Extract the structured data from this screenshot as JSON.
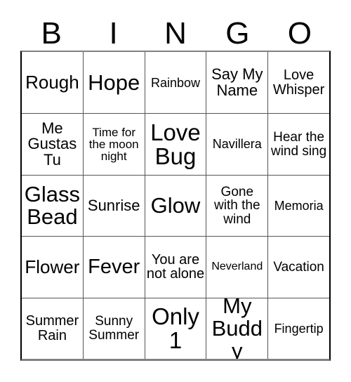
{
  "card": {
    "title_letters": [
      "B",
      "I",
      "N",
      "G",
      "O"
    ],
    "columns": 5,
    "rows": 5,
    "border_color": "#000000",
    "grid_line_color": "#555555",
    "background_color": "#ffffff",
    "text_color": "#000000",
    "rows_data": [
      [
        {
          "text": "Rough",
          "size": "fs-xl"
        },
        {
          "text": "Hope",
          "size": "fs-xxxl"
        },
        {
          "text": "Rainbow",
          "size": "fs-sm"
        },
        {
          "text": "Say My Name",
          "size": "fs-l"
        },
        {
          "text": "Love Whisper",
          "size": "fs-ml"
        }
      ],
      [
        {
          "text": "Me Gustas Tu",
          "size": "fs-l"
        },
        {
          "text": "Time for the moon night",
          "size": "fs-s"
        },
        {
          "text": "Love Bug",
          "size": "fs-huge"
        },
        {
          "text": "Navillera",
          "size": "fs-sm"
        },
        {
          "text": "Hear the wind sing",
          "size": "fs-m"
        }
      ],
      [
        {
          "text": "Glass Bead",
          "size": "fs-xxxl"
        },
        {
          "text": "Sunrise",
          "size": "fs-l"
        },
        {
          "text": "Glow",
          "size": "fs-xxxl"
        },
        {
          "text": "Gone with the wind",
          "size": "fs-m"
        },
        {
          "text": "Memoria",
          "size": "fs-sm"
        }
      ],
      [
        {
          "text": "Flower",
          "size": "fs-xl"
        },
        {
          "text": "Fever",
          "size": "fs-xxl"
        },
        {
          "text": "You are not alone",
          "size": "fs-ml"
        },
        {
          "text": "Neverland",
          "size": "fs-xs"
        },
        {
          "text": "Vacation",
          "size": "fs-m"
        }
      ],
      [
        {
          "text": "Summer Rain",
          "size": "fs-ml"
        },
        {
          "text": "Sunny Summer",
          "size": "fs-m"
        },
        {
          "text": "Only 1",
          "size": "fs-huge"
        },
        {
          "text": "My Buddy",
          "size": "fs-xxxl"
        },
        {
          "text": "Fingertip",
          "size": "fs-sm"
        }
      ]
    ]
  }
}
